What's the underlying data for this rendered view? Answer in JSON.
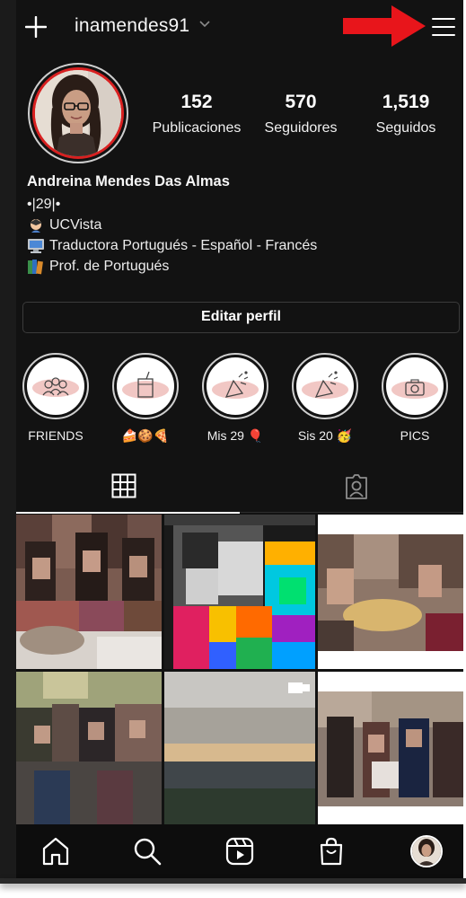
{
  "header": {
    "username": "inamendes91",
    "icons": [
      "plus-icon",
      "chevron-down-icon",
      "red-arrow-annotation",
      "menu-icon"
    ]
  },
  "profile": {
    "stats": [
      {
        "value": "152",
        "label": "Publicaciones"
      },
      {
        "value": "570",
        "label": "Seguidores"
      },
      {
        "value": "1,519",
        "label": "Seguidos"
      }
    ],
    "name": "Andreina Mendes Das Almas",
    "bio": [
      {
        "text": "•|29|•"
      },
      {
        "icon": "woman-student-emoji",
        "text": "UCVista"
      },
      {
        "icon": "computer-emoji",
        "text": "Traductora Portugués - Español - Francés"
      },
      {
        "icon": "books-emoji",
        "text": "Prof. de Portugués"
      }
    ],
    "edit_button": "Editar perfil"
  },
  "highlights": [
    {
      "label": "FRIENDS",
      "icon": "friends-icon"
    },
    {
      "label": "🍰🍪🍕",
      "icon": "drink-icon"
    },
    {
      "label": "Mis 29 🎈",
      "icon": "party-icon"
    },
    {
      "label": "Sis 20 🥳",
      "icon": "party-icon"
    },
    {
      "label": "PICS",
      "icon": "camera-icon"
    }
  ],
  "tabs": [
    {
      "name": "grid",
      "icon": "grid-icon",
      "active": true
    },
    {
      "name": "tagged",
      "icon": "tagged-icon",
      "active": false
    }
  ],
  "nav": [
    "home-icon",
    "search-icon",
    "reels-icon",
    "shop-icon",
    "profile-avatar"
  ],
  "colors": {
    "background": "#121212",
    "annotation_red": "#e8151b",
    "avatar_ring_red": "#d82020"
  }
}
